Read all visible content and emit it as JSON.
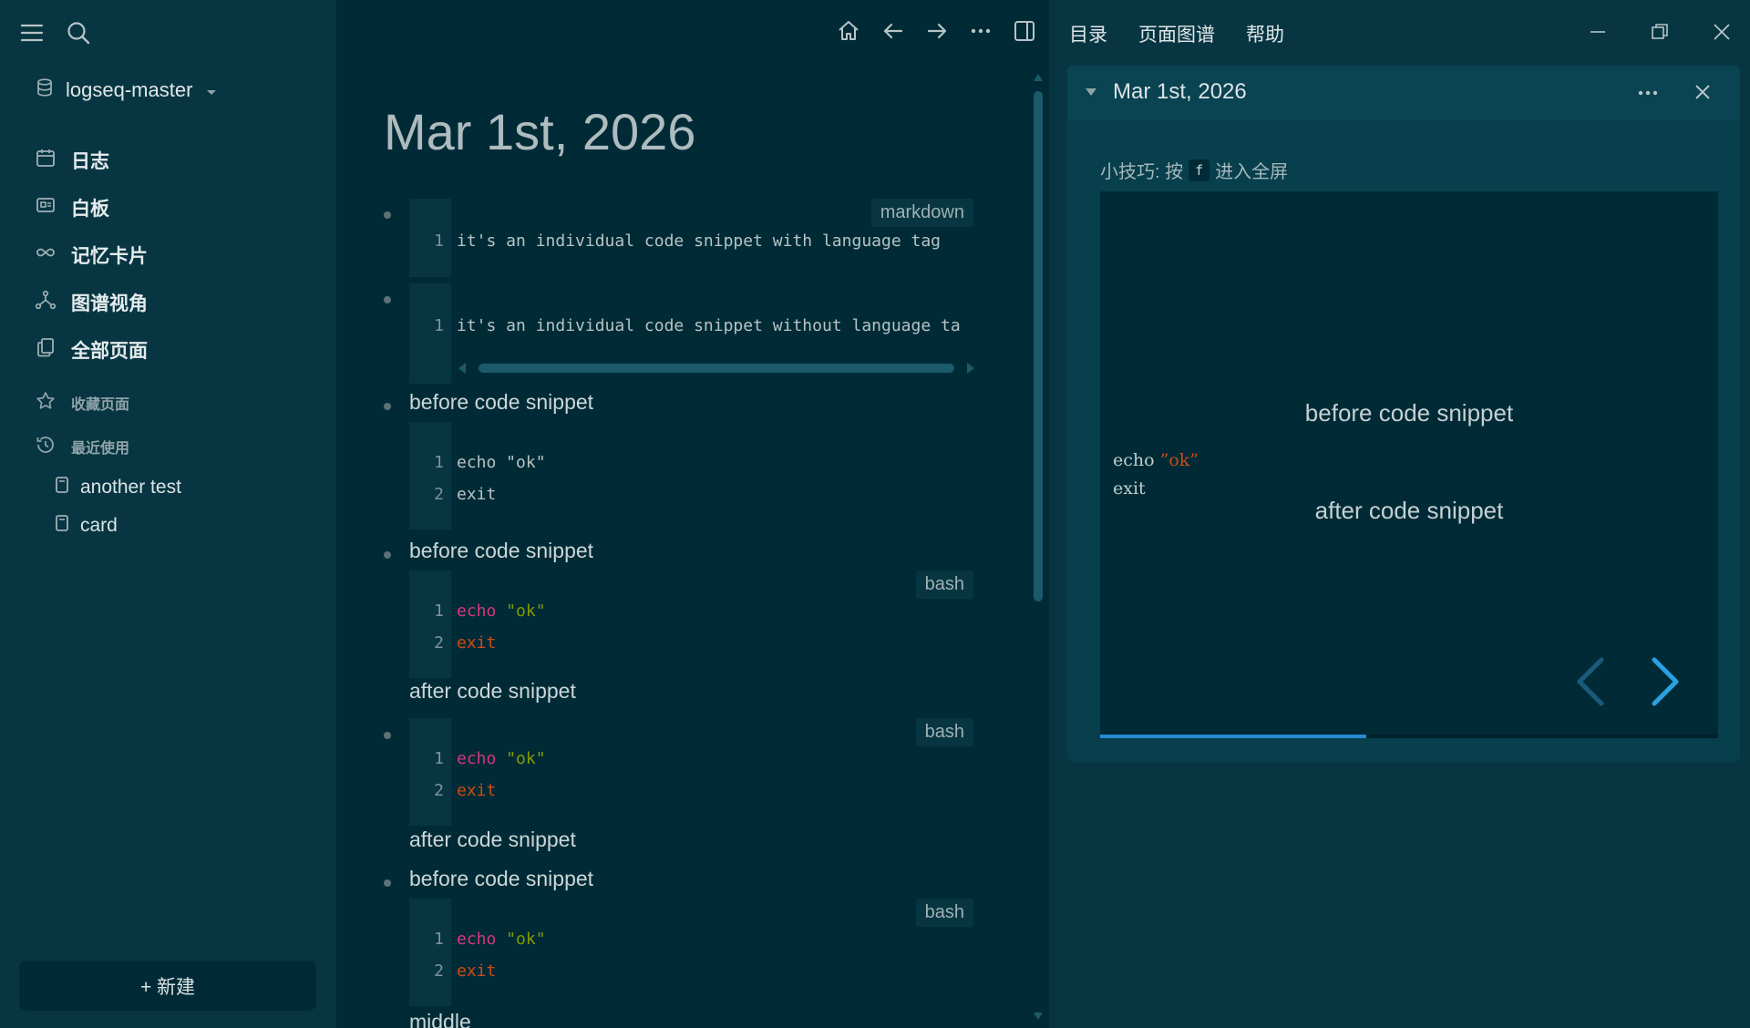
{
  "sidebar": {
    "graph_name": "logseq-master",
    "nav": [
      {
        "label": "日志",
        "icon": "calendar-icon"
      },
      {
        "label": "白板",
        "icon": "whiteboard-icon"
      },
      {
        "label": "记忆卡片",
        "icon": "infinity-icon"
      },
      {
        "label": "图谱视角",
        "icon": "graph-icon"
      },
      {
        "label": "全部页面",
        "icon": "pages-icon"
      }
    ],
    "favorites_label": "收藏页面",
    "recent_label": "最近使用",
    "recent": [
      {
        "label": "another test"
      },
      {
        "label": "card"
      }
    ],
    "new_label": "+ 新建"
  },
  "main": {
    "title": "Mar 1st, 2026",
    "blocks": {
      "b1": {
        "lang": "markdown",
        "line": "it's an individual code snippet with language tag"
      },
      "b2": {
        "line": "it's an individual code snippet without language ta"
      },
      "b3": {
        "before": "before code snippet",
        "l1": "echo \"ok\"",
        "l2": "exit"
      },
      "b4": {
        "before": "before code snippet",
        "lang": "bash",
        "kw": "echo",
        "str": "\"ok\"",
        "exit": "exit",
        "after": "after code snippet"
      },
      "b5": {
        "lang": "bash",
        "kw": "echo",
        "str": "\"ok\"",
        "exit": "exit",
        "after": "after code snippet"
      },
      "b6": {
        "before": "before code snippet",
        "lang": "bash",
        "kw": "echo",
        "str": "\"ok\"",
        "exit": "exit",
        "after": "middle"
      }
    }
  },
  "right": {
    "menu": [
      "目录",
      "页面图谱",
      "帮助"
    ],
    "card_title": "Mar 1st, 2026",
    "tip_prefix": "小技巧: 按",
    "tip_key": "f",
    "tip_suffix": "进入全屏",
    "slide": {
      "line1": "before code snippet",
      "code_echo": "echo",
      "code_str": "”ok”",
      "code_exit": "exit",
      "line2": "after code snippet",
      "progress": 0.43
    }
  }
}
